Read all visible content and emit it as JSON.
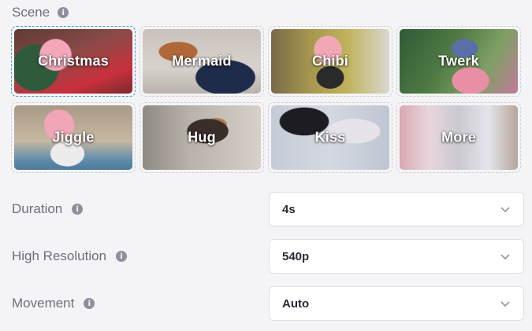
{
  "scene": {
    "label": "Scene",
    "info_icon": "info-icon",
    "items": [
      {
        "label": "Christmas",
        "selected": true
      },
      {
        "label": "Mermaid",
        "selected": false
      },
      {
        "label": "Chibi",
        "selected": false
      },
      {
        "label": "Twerk",
        "selected": false
      },
      {
        "label": "Jiggle",
        "selected": false
      },
      {
        "label": "Hug",
        "selected": false
      },
      {
        "label": "Kiss",
        "selected": false
      },
      {
        "label": "More",
        "selected": false
      }
    ]
  },
  "fields": {
    "duration": {
      "label": "Duration",
      "value": "4s"
    },
    "resolution": {
      "label": "High Resolution",
      "value": "540p"
    },
    "movement": {
      "label": "Movement",
      "value": "Auto"
    }
  },
  "colors": {
    "background": "#f4f4f6",
    "selected_border": "#3aa0c8",
    "label_text": "#6e6e7e",
    "value_text": "#2a2a35"
  }
}
